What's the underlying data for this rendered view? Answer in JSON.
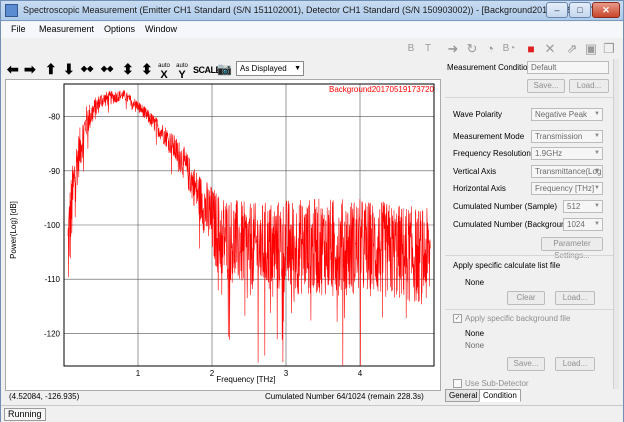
{
  "window": {
    "title": "Spectroscopic Measurement (Emitter CH1 Standard (S/N 151102001), Detector CH1 Standard (S/N 150903002)) - [Background20170519173720]",
    "minimize": "–",
    "maximize": "□",
    "close": "✕"
  },
  "menu": [
    "File",
    "Measurement",
    "Options",
    "Window"
  ],
  "left_toolbar": {
    "buttons": [
      {
        "icon": "arrow-left-icon",
        "glyph": "⬅"
      },
      {
        "icon": "arrow-right-icon",
        "glyph": "➡"
      },
      {
        "icon": "arrow-up-icon",
        "glyph": "⬆"
      },
      {
        "icon": "arrow-down-icon",
        "glyph": "⬇"
      },
      {
        "icon": "compress-horizontal-icon",
        "glyph": "◆◆"
      },
      {
        "icon": "expand-horizontal-icon",
        "glyph": "◆◆"
      },
      {
        "icon": "expand-vertical-icon",
        "glyph": "⬍"
      },
      {
        "icon": "compress-vertical-icon",
        "glyph": "⬍"
      }
    ],
    "auto_x": {
      "top": "auto",
      "bottom": "X"
    },
    "auto_y": {
      "top": "auto",
      "bottom": "Y"
    },
    "scale_label": "SCALE",
    "camera_icon": "camera-icon",
    "display_mode": "As Displayed"
  },
  "right_toolbar": {
    "icons": [
      "b-pin-icon",
      "t-pin-icon",
      "step-arrow-icon",
      "refresh-icon",
      "clock-icon",
      "b-clock-icon",
      "stop-icon",
      "cancel-icon",
      "expand-arrow-icon",
      "save-icon",
      "copy-icon"
    ],
    "colors": {
      "stop": "#e02020",
      "disabled": "#9a9a9a"
    }
  },
  "chart_data": {
    "type": "line",
    "series_name": "Background20170519173720",
    "xlabel": "Frequency [THz]",
    "ylabel": "Power(Log) [dB]",
    "xlim": [
      0,
      5
    ],
    "ylim": [
      -126,
      -74
    ],
    "xticks": [
      1,
      2,
      3,
      4
    ],
    "yticks": [
      -80,
      -90,
      -100,
      -110,
      -120
    ],
    "grid": true,
    "line_color": "#ff0000",
    "x": [
      0.05,
      0.15,
      0.3,
      0.5,
      0.8,
      1.0,
      1.2,
      1.4,
      1.6,
      1.8,
      1.95,
      2.1,
      2.5,
      3.0,
      3.5,
      4.0,
      4.5,
      4.95
    ],
    "y": [
      -105,
      -90,
      -81,
      -77,
      -76,
      -78,
      -81,
      -84,
      -88,
      -94,
      -98,
      -102,
      -104,
      -104,
      -104,
      -104,
      -105,
      -106
    ],
    "noise_amplitude": [
      10,
      5,
      3,
      1.5,
      1,
      1,
      1.5,
      2,
      3,
      4,
      6,
      8,
      8,
      9,
      9,
      9,
      9,
      9
    ]
  },
  "status": {
    "cursor": "(4.52084, -126.935)",
    "cumulated": "Cumulated Number 64/1024 (remain 228.3s)",
    "state": "Running"
  },
  "panel": {
    "measurement_condition_label": "Measurement Condition",
    "measurement_condition_value": "Default",
    "save_button": "Save...",
    "load_button": "Load...",
    "wave_polarity_label": "Wave Polarity",
    "wave_polarity_value": "Negative Peak",
    "measurement_mode_label": "Measurement Mode",
    "measurement_mode_value": "Transmission",
    "frequency_resolution_label": "Frequency Resolution",
    "frequency_resolution_value": "1.9GHz",
    "vertical_axis_label": "Vertical Axis",
    "vertical_axis_value": "Transmittance(Log",
    "horizontal_axis_label": "Horizontal Axis",
    "horizontal_axis_value": "Frequency [THz]",
    "cumulated_sample_label": "Cumulated Number (Sample)",
    "cumulated_sample_value": "512",
    "cumulated_background_label": "Cumulated Number (Background)",
    "cumulated_background_value": "1024",
    "parameter_settings_button": "Parameter Settings...",
    "calc_list_label": "Apply specific calculate list file",
    "calc_list_value": "None",
    "clear_button": "Clear",
    "load2_button": "Load...",
    "background_file_label": "Apply specific background file",
    "background_file_check": "✓",
    "background_file_value1": "None",
    "background_file_value2": "None",
    "save3_button": "Save...",
    "load3_button": "Load...",
    "sub_detector_label": "Use Sub-Detector"
  },
  "tabs": [
    "General",
    "Condition"
  ]
}
